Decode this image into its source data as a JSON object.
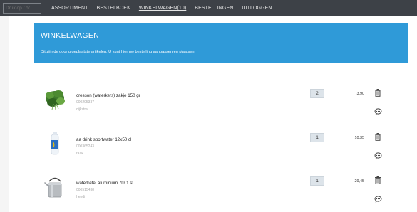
{
  "topbar": {
    "search_placeholder": "Druk op / or",
    "nav": [
      "ASSORTIMENT",
      "BESTELBOEK",
      "WINKELWAGEN(10)",
      "BESTELLINGEN",
      "UITLOGGEN"
    ]
  },
  "banner": {
    "title": "WINKELWAGEN",
    "subtitle": "Dit zijn de door u geplaatste artikelen. U kunt hier uw bestelling aanpassen en plaatsen."
  },
  "items": [
    {
      "name": "cresson (waterkers) zakje 150 gr",
      "code": "000295337",
      "brand": "dijkstra",
      "qty": "2",
      "price": "3,90",
      "image": "cress-image"
    },
    {
      "name": "aa drink sportwater 12x50 cl",
      "code": "000365243",
      "brand": "raak",
      "qty": "1",
      "price": "10,35",
      "image": "bottle-image"
    },
    {
      "name": "waterketel aluminium 7ltr 1 st",
      "code": "000515438",
      "brand": "hendi",
      "qty": "1",
      "price": "29,45",
      "image": "kettle-image"
    }
  ],
  "colors": {
    "topbar": "#3d4147",
    "banner": "#2f9ad8"
  }
}
